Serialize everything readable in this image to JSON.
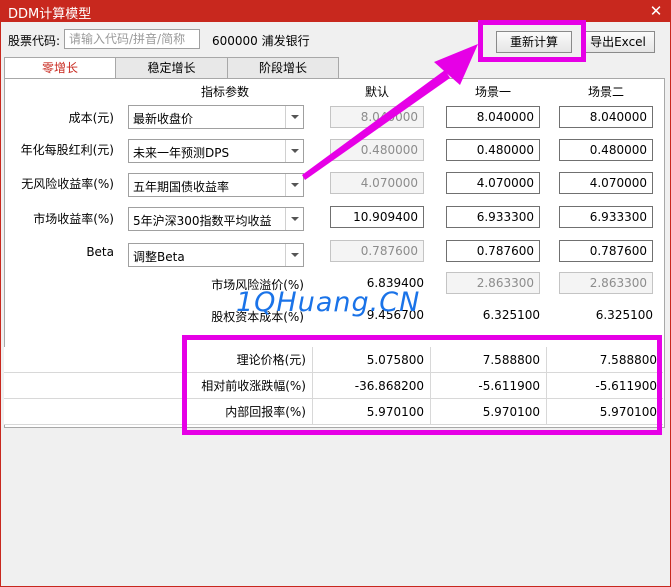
{
  "window": {
    "title": "DDM计算模型",
    "close_glyph": "✕"
  },
  "toolbar": {
    "stock_code_label": "股票代码:",
    "search_placeholder": "请输入代码/拼音/简称",
    "stock_display": "600000 浦发银行",
    "recalc_label": "重新计算",
    "export_label": "导出Excel"
  },
  "tabs": [
    {
      "label": "零增长",
      "active": true
    },
    {
      "label": "稳定增长",
      "active": false
    },
    {
      "label": "阶段增长",
      "active": false
    }
  ],
  "headers": {
    "param": "指标参数",
    "default": "默认",
    "s1": "场景一",
    "s2": "场景二"
  },
  "params": [
    {
      "label": "成本(元)",
      "select": "最新收盘价",
      "default": "8.040000",
      "s1": "8.040000",
      "s2": "8.040000"
    },
    {
      "label": "年化每股红利(元)",
      "select": "未来一年预测DPS",
      "default": "0.480000",
      "s1": "0.480000",
      "s2": "0.480000"
    },
    {
      "label": "无风险收益率(%)",
      "select": "五年期国债收益率",
      "default": "4.070000",
      "s1": "4.070000",
      "s2": "4.070000"
    },
    {
      "label": "市场收益率(%)",
      "select": "5年沪深300指数平均收益",
      "default": "10.909400",
      "s1": "6.933300",
      "s2": "6.933300"
    },
    {
      "label": "Beta",
      "select": "调整Beta",
      "default": "0.787600",
      "s1": "0.787600",
      "s2": "0.787600"
    }
  ],
  "derived": [
    {
      "label": "市场风险溢价(%)",
      "default": "6.839400",
      "s1": "2.863300",
      "s2": "2.863300"
    },
    {
      "label": "股权资本成本(%)",
      "default": "9.456700",
      "s1": "6.325100",
      "s2": "6.325100"
    }
  ],
  "results": [
    {
      "label": "理论价格(元)",
      "default": "5.075800",
      "s1": "7.588800",
      "s2": "7.588800"
    },
    {
      "label": "相对前收涨跌幅(%)",
      "default": "-36.868200",
      "s1": "-5.611900",
      "s2": "-5.611900"
    },
    {
      "label": "内部回报率(%)",
      "default": "5.970100",
      "s1": "5.970100",
      "s2": "5.970100"
    }
  ],
  "watermark": "1QHuang.CN",
  "colors": {
    "title_bar": "#c8281e",
    "highlight": "#e600e6",
    "active_tab_text": "#c8281e",
    "watermark": "#1a73e8"
  }
}
